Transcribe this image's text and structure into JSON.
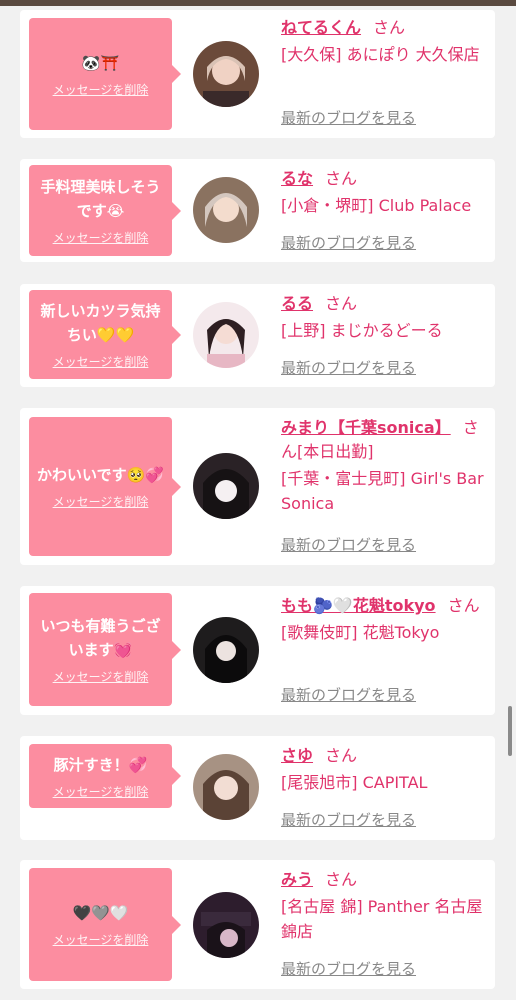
{
  "messages": [
    {
      "text": "🐼⛩️",
      "delete_label": "メッセージを削除",
      "name": "ねてるくん",
      "honorific": "さん",
      "shop": "[大久保] あにぽり 大久保店",
      "blog_label": "最新のブログを見る",
      "avatar_color": "#6b4a3a"
    },
    {
      "text": "手料理美味しそうです😭",
      "delete_label": "メッセージを削除",
      "name": "るな",
      "honorific": "さん",
      "shop": "[小倉・堺町] Club Palace",
      "blog_label": "最新のブログを見る",
      "avatar_color": "#8a7260"
    },
    {
      "text": "新しいカツラ気持ちい💛💛",
      "delete_label": "メッセージを削除",
      "name": "るる",
      "honorific": "さん",
      "shop": "[上野] まじかるどーる",
      "blog_label": "最新のブログを見る",
      "avatar_color": "#e9c8cf"
    },
    {
      "text": "かわいいです🥺💞",
      "delete_label": "メッセージを削除",
      "name": "みまり【千葉sonica】",
      "honorific": "さん[本日出勤]",
      "shop": "[千葉・富士見町] Girl's Bar Sonica",
      "blog_label": "最新のブログを見る",
      "avatar_color": "#2a2226"
    },
    {
      "text": "いつも有難うございます💓",
      "delete_label": "メッセージを削除",
      "name": "もも🫐🤍花魁tokyo",
      "honorific": "さん",
      "shop": "[歌舞伎町] 花魁Tokyo",
      "blog_label": "最新のブログを見る",
      "avatar_color": "#1e1c1d"
    },
    {
      "text": "豚汁すき！💞",
      "delete_label": "メッセージを削除",
      "name": "さゆ",
      "honorific": "さん",
      "shop": "[尾張旭市] CAPITAL",
      "blog_label": "最新のブログを見る",
      "avatar_color": "#7d6a5f"
    },
    {
      "text": "🖤🩶🤍",
      "delete_label": "メッセージを削除",
      "name": "みう",
      "honorific": "さん",
      "shop": "[名古屋 錦] Panther 名古屋錦店",
      "blog_label": "最新のブログを見る",
      "avatar_color": "#2d1d2d"
    }
  ]
}
